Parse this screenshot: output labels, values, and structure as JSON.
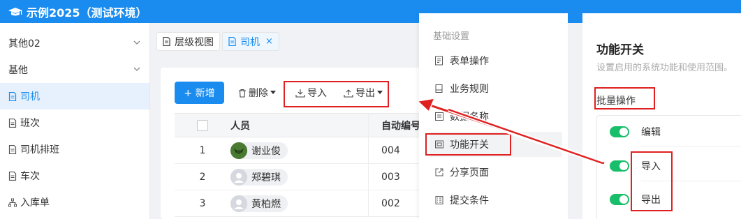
{
  "app": {
    "title": "示例2025（测试环境）"
  },
  "sidebar": {
    "items": [
      {
        "label": "其他02",
        "expandable": true
      },
      {
        "label": "基他",
        "expandable": true
      },
      {
        "label": "司机",
        "active": true
      },
      {
        "label": "班次"
      },
      {
        "label": "司机排班"
      },
      {
        "label": "车次"
      },
      {
        "label": "入库单"
      }
    ]
  },
  "tabs": [
    {
      "label": "层级视图"
    },
    {
      "label": "司机",
      "active": true,
      "close": "×"
    }
  ],
  "toolbar": {
    "add_label": "+ 新增",
    "delete_label": "删除",
    "import_label": "导入",
    "export_label": "导出"
  },
  "table": {
    "headers": {
      "person": "人员",
      "code": "自动编号"
    },
    "rows": [
      {
        "idx": "1",
        "person": "谢业俊",
        "code": "004",
        "avatar": "photo"
      },
      {
        "idx": "2",
        "person": "郑碧琪",
        "code": "003",
        "avatar": "default"
      },
      {
        "idx": "3",
        "person": "黄柏燃",
        "code": "002",
        "avatar": "default"
      }
    ]
  },
  "menu": {
    "heading": "基础设置",
    "items": [
      {
        "label": "表单操作",
        "icon": "form-icon"
      },
      {
        "label": "业务规则",
        "icon": "rule-icon"
      },
      {
        "label": "数据名称",
        "icon": "data-name-icon"
      },
      {
        "label": "功能开关",
        "icon": "switch-icon",
        "selected": true
      },
      {
        "label": "分享页面",
        "icon": "share-icon"
      },
      {
        "label": "提交条件",
        "icon": "submit-icon"
      }
    ]
  },
  "panel": {
    "title": "功能开关",
    "subtitle": "设置启用的系统功能和使用范围。",
    "section": "批量操作",
    "switches": [
      {
        "label": "编辑",
        "on": true
      },
      {
        "label": "导入",
        "on": true
      },
      {
        "label": "导出",
        "on": true
      }
    ]
  },
  "colors": {
    "primary": "#1a8cf0",
    "toggle_on": "#19be6b",
    "annotation": "#e02020"
  }
}
